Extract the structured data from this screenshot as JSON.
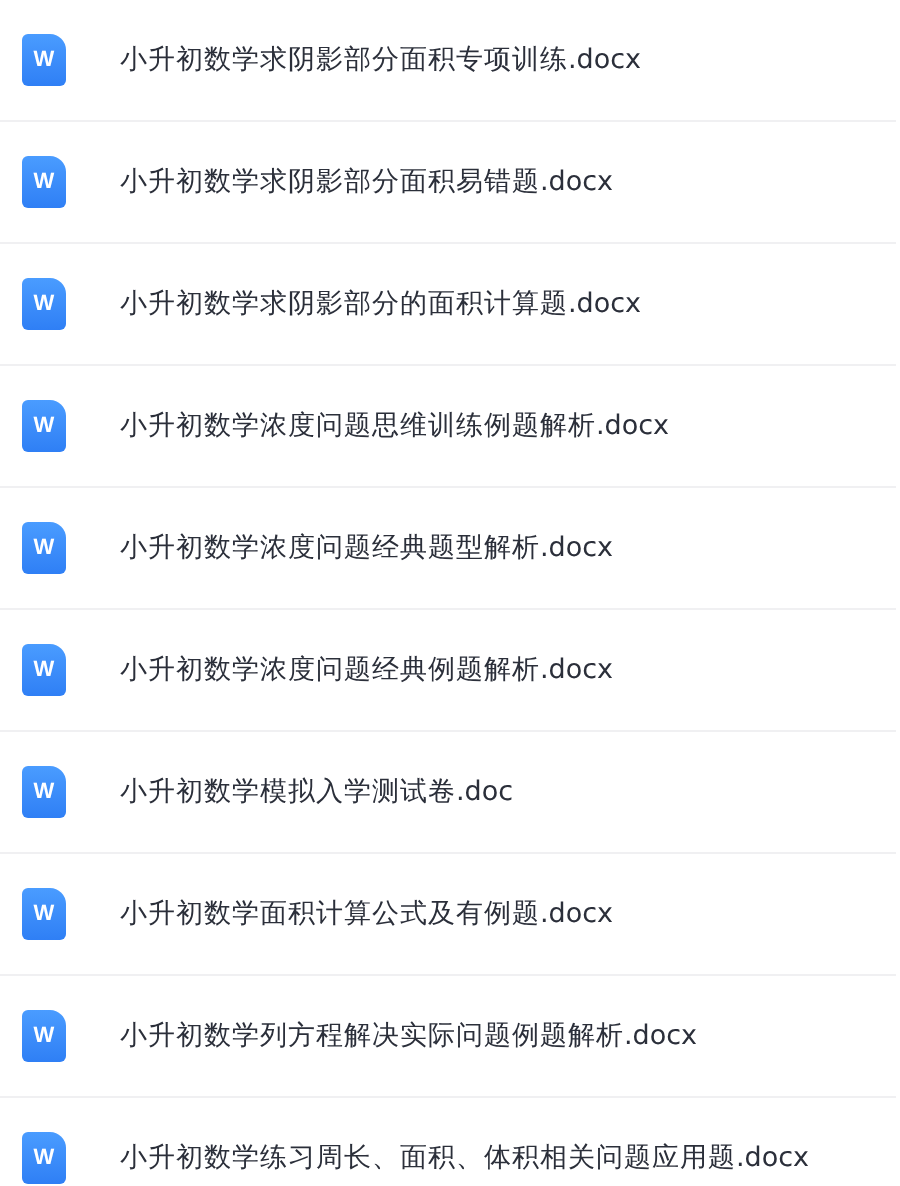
{
  "files": [
    {
      "icon": "W",
      "name": "小升初数学求阴影部分面积专项训练.docx"
    },
    {
      "icon": "W",
      "name": "小升初数学求阴影部分面积易错题.docx"
    },
    {
      "icon": "W",
      "name": "小升初数学求阴影部分的面积计算题.docx"
    },
    {
      "icon": "W",
      "name": "小升初数学浓度问题思维训练例题解析.docx"
    },
    {
      "icon": "W",
      "name": "小升初数学浓度问题经典题型解析.docx"
    },
    {
      "icon": "W",
      "name": "小升初数学浓度问题经典例题解析.docx"
    },
    {
      "icon": "W",
      "name": "小升初数学模拟入学测试卷.doc"
    },
    {
      "icon": "W",
      "name": "小升初数学面积计算公式及有例题.docx"
    },
    {
      "icon": "W",
      "name": "小升初数学列方程解决实际问题例题解析.docx"
    },
    {
      "icon": "W",
      "name": "小升初数学练习周长、面积、体积相关问题应用题.docx"
    }
  ]
}
